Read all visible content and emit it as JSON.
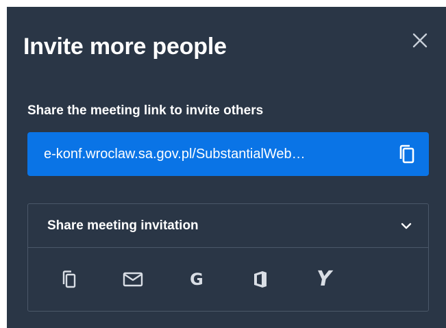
{
  "dialog": {
    "title": "Invite more people",
    "subtitle": "Share the meeting link to invite others",
    "meeting_link": "e-konf.wroclaw.sa.gov.pl/SubstantialWeb…",
    "share_section_title": "Share meeting invitation",
    "share_options": [
      "copy-invitation",
      "email",
      "google",
      "office365",
      "yahoo"
    ],
    "share_google_glyph": "G",
    "share_yahoo_glyph": "Y"
  },
  "colors": {
    "dialog_bg": "#2a3646",
    "link_bar_bg": "#0a74e6",
    "border": "#4b5869",
    "text": "#ffffff",
    "icon": "#d9dee5"
  }
}
